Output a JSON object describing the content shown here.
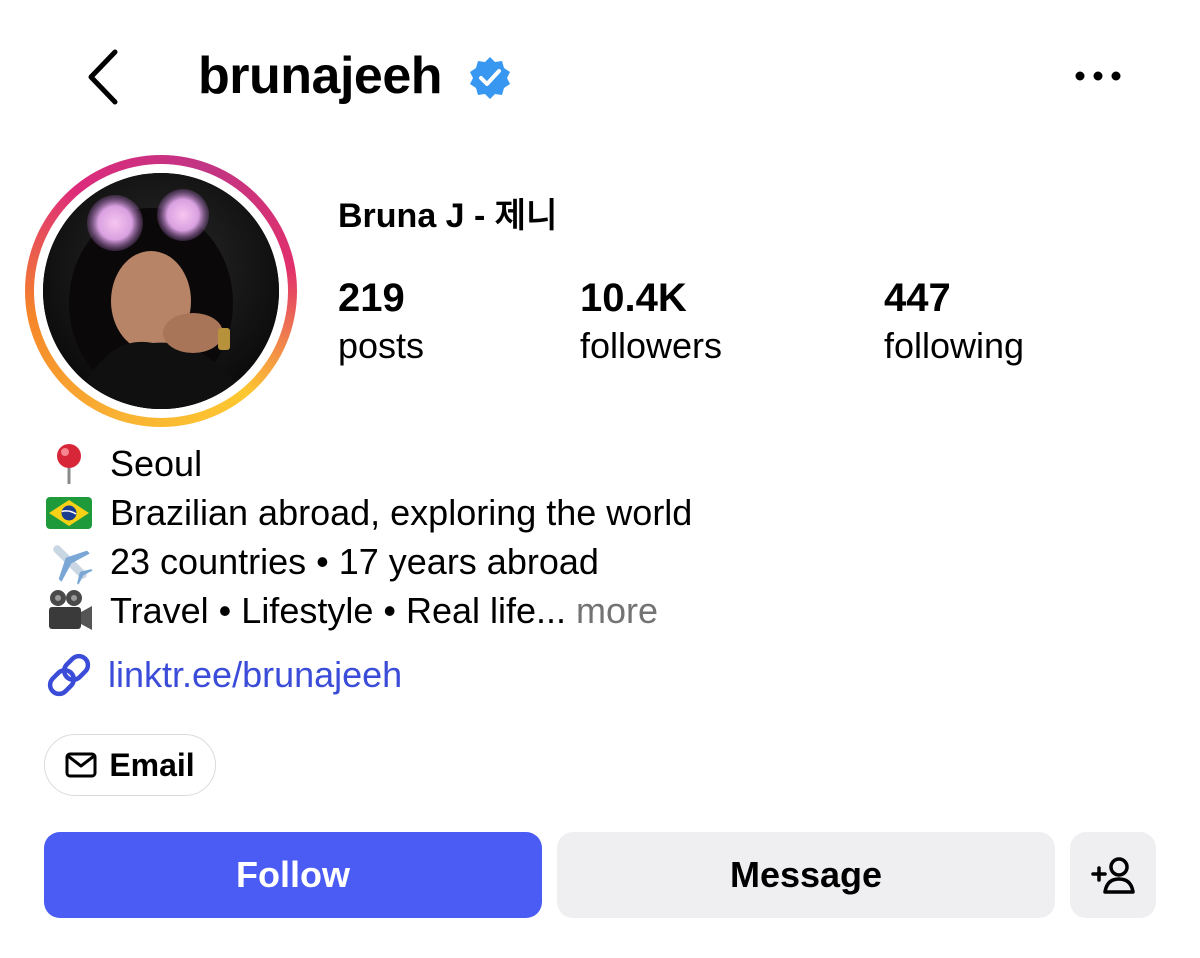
{
  "header": {
    "username": "brunajeeh",
    "back_icon": "chevron-left-icon",
    "verified_icon": "verified-badge-icon",
    "verified_color": "#3897f0",
    "more_icon": "more-horizontal-icon"
  },
  "profile": {
    "display_name": "Bruna J -  제니",
    "avatar_icon": "profile-photo"
  },
  "stats": [
    {
      "value": "219",
      "label": "posts"
    },
    {
      "value": "10.4K",
      "label": "followers"
    },
    {
      "value": "447",
      "label": "following"
    }
  ],
  "bio": {
    "lines": [
      {
        "icon": "round-pushpin-emoji",
        "text": "Seoul"
      },
      {
        "icon": "brazil-flag-emoji",
        "text": "Brazilian abroad, exploring the world"
      },
      {
        "icon": "airplane-emoji",
        "text": "23 countries • 17 years abroad"
      },
      {
        "icon": "movie-camera-emoji",
        "text": "Travel • Lifestyle • Real life..."
      }
    ],
    "more_label": "more",
    "link_icon": "link-icon",
    "link": "linktr.ee/brunajeeh"
  },
  "contact": {
    "email_label": "Email",
    "email_icon": "envelope-icon"
  },
  "actions": {
    "follow_label": "Follow",
    "message_label": "Message",
    "add_user_icon": "add-person-icon",
    "follow_color": "#4b5cf5",
    "secondary_color": "#efeff2"
  }
}
